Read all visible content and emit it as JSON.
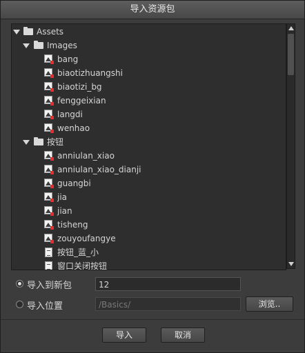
{
  "dialog": {
    "title": "导入资源包"
  },
  "tree": {
    "items": [
      {
        "label": "Assets",
        "icon": "folder-icon",
        "expanded": true
      },
      {
        "label": "Images",
        "icon": "folder-icon",
        "expanded": true
      },
      {
        "label": "bang",
        "icon": "image-icon"
      },
      {
        "label": "biaotizhuangshi",
        "icon": "image-icon"
      },
      {
        "label": "biaotizi_bg",
        "icon": "image-icon"
      },
      {
        "label": "fenggeixian",
        "icon": "image-icon"
      },
      {
        "label": "langdi",
        "icon": "image-icon"
      },
      {
        "label": "wenhao",
        "icon": "image-icon"
      },
      {
        "label": "按钮",
        "icon": "folder-icon",
        "expanded": true
      },
      {
        "label": "anniulan_xiao",
        "icon": "image-icon"
      },
      {
        "label": "anniulan_xiao_dianji",
        "icon": "image-icon"
      },
      {
        "label": "guangbi",
        "icon": "image-icon"
      },
      {
        "label": "jia",
        "icon": "image-icon"
      },
      {
        "label": "jian",
        "icon": "image-icon"
      },
      {
        "label": "tisheng",
        "icon": "image-icon"
      },
      {
        "label": "zouyoufangye",
        "icon": "image-icon"
      },
      {
        "label": "按钮_蓝_小",
        "icon": "document-icon"
      },
      {
        "label": "窗口关闭按钮",
        "icon": "document-icon"
      }
    ]
  },
  "options": {
    "new_package_label": "导入到新包",
    "new_package_value": "12",
    "location_label": "导入位置",
    "location_placeholder": "/Basics/",
    "browse_label": "浏览.."
  },
  "footer": {
    "import_label": "导入",
    "cancel_label": "取消"
  },
  "colors": {
    "background": "#3c3c3c",
    "tree_background": "#2e2e2e",
    "badge_red": "#e03030"
  }
}
